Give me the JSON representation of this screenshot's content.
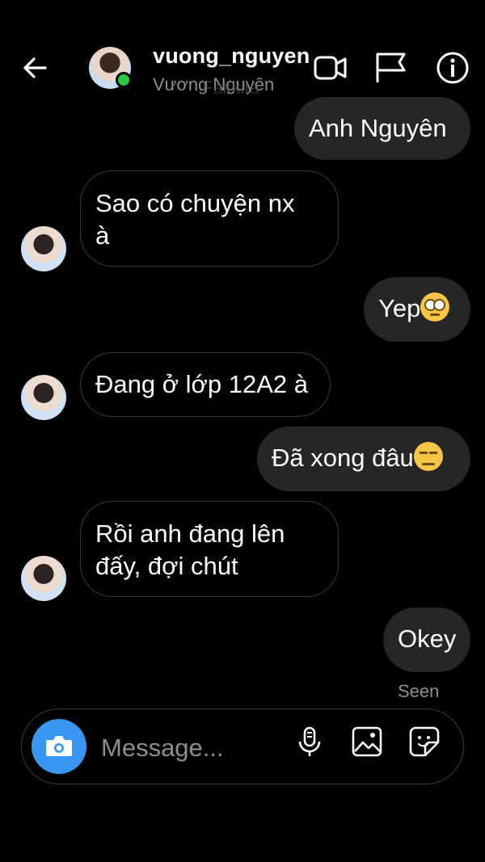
{
  "header": {
    "username": "vuong_nguyen",
    "full_name": "Vương Nguyên",
    "watermark": "Fakkita"
  },
  "messages": [
    {
      "side": "out",
      "text": "Anh Nguyên"
    },
    {
      "side": "in",
      "text_line1": "Sao có chuyện nx",
      "text_line2": "à"
    },
    {
      "side": "out",
      "text": "Yep",
      "emoji": "face-with-rolling-eyes"
    },
    {
      "side": "in",
      "text": "Đang ở lớp 12A2 à"
    },
    {
      "side": "out",
      "text": "Đã xong đâu",
      "emoji": "expressionless-face"
    },
    {
      "side": "in",
      "text_line1": "Rồi anh đang lên",
      "text_line2": "đấy, đợi chút"
    },
    {
      "side": "out",
      "text": "Okey"
    }
  ],
  "status": {
    "seen": "Seen"
  },
  "composer": {
    "placeholder": "Message..."
  },
  "colors": {
    "online": "#28c840",
    "camera_button": "#3897f0",
    "outgoing_bubble": "#262626"
  }
}
